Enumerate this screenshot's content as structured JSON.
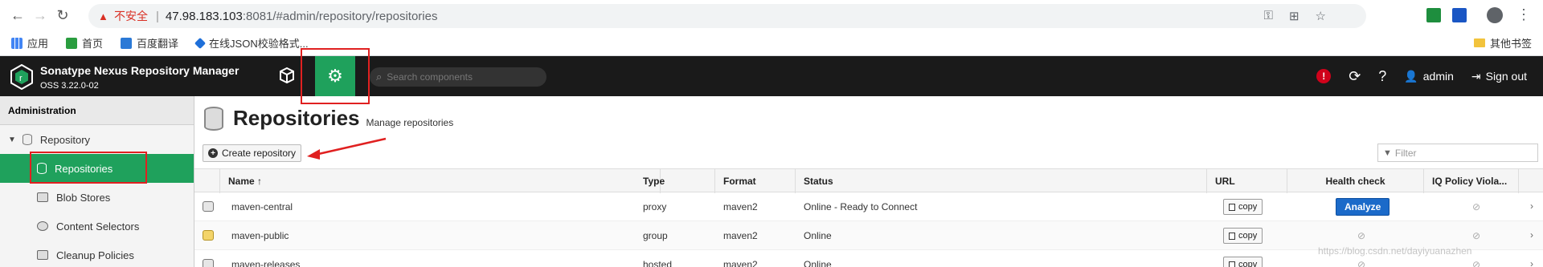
{
  "browser": {
    "insecure_label": "不安全",
    "url_host": "47.98.183.103",
    "url_rest": ":8081/#admin/repository/repositories"
  },
  "bookmarks": {
    "apps": "应用",
    "home": "首页",
    "translate": "百度翻译",
    "json": "在线JSON校验格式...",
    "other": "其他书签"
  },
  "header": {
    "title": "Sonatype Nexus Repository Manager",
    "version": "OSS 3.22.0-02",
    "search_placeholder": "Search components",
    "user": "admin",
    "signout": "Sign out"
  },
  "sidebar": {
    "heading": "Administration",
    "group": "Repository",
    "items": [
      {
        "label": "Repositories"
      },
      {
        "label": "Blob Stores"
      },
      {
        "label": "Content Selectors"
      },
      {
        "label": "Cleanup Policies"
      }
    ]
  },
  "main": {
    "title": "Repositories",
    "subtitle": "Manage repositories",
    "create_label": "Create repository",
    "filter_placeholder": "Filter"
  },
  "table": {
    "headers": {
      "name": "Name ↑",
      "type": "Type",
      "format": "Format",
      "status": "Status",
      "url": "URL",
      "health": "Health check",
      "iq": "IQ Policy Viola..."
    },
    "copy_label": "copy",
    "analyze_label": "Analyze",
    "rows": [
      {
        "name": "maven-central",
        "type": "proxy",
        "format": "maven2",
        "status": "Online - Ready to Connect"
      },
      {
        "name": "maven-public",
        "type": "group",
        "format": "maven2",
        "status": "Online"
      },
      {
        "name": "maven-releases",
        "type": "hosted",
        "format": "maven2",
        "status": "Online"
      }
    ]
  },
  "watermark": "https://blog.csdn.net/dayiyuanazhen",
  "colors": {
    "nexus_green": "#1fa15c",
    "header_black": "#1a1a1a",
    "annotation_red": "#e02020",
    "analyze_blue": "#1b6ac9"
  }
}
